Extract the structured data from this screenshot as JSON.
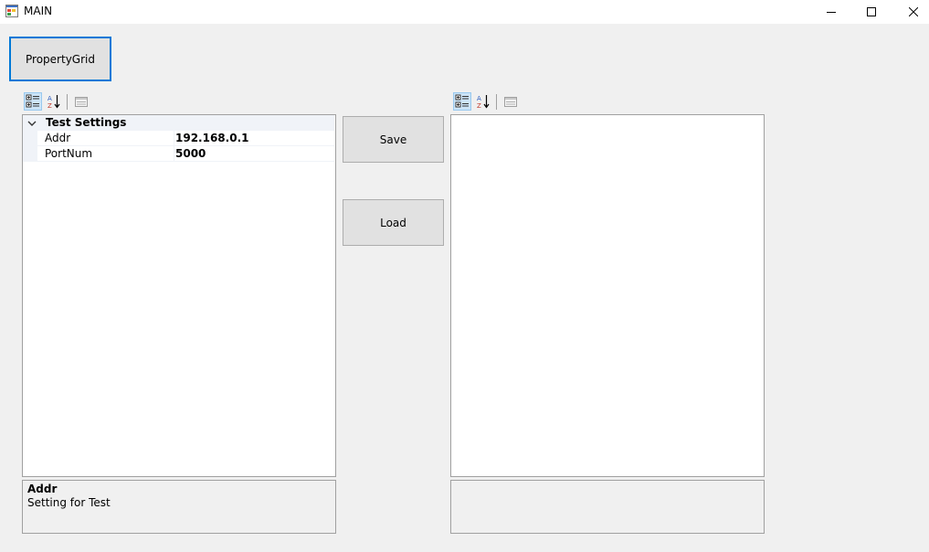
{
  "window": {
    "title": "MAIN"
  },
  "top_button": {
    "label": "PropertyGrid"
  },
  "left_grid": {
    "category": "Test Settings",
    "properties": [
      {
        "name": "Addr",
        "value": "192.168.0.1"
      },
      {
        "name": "PortNum",
        "value": "5000"
      }
    ],
    "description": {
      "title": "Addr",
      "text": "Setting for Test"
    }
  },
  "middle": {
    "save_label": "Save",
    "load_label": "Load"
  },
  "icons": {
    "categorized": "categorized-icon",
    "alphabetical": "sort-alphabetical-icon",
    "property_pages": "property-pages-icon",
    "minimize": "minimize-icon",
    "maximize": "maximize-icon",
    "close": "close-icon"
  },
  "colors": {
    "focus": "#0078d7",
    "category_bg": "#f0f3f8",
    "background": "#f0f0f0"
  }
}
